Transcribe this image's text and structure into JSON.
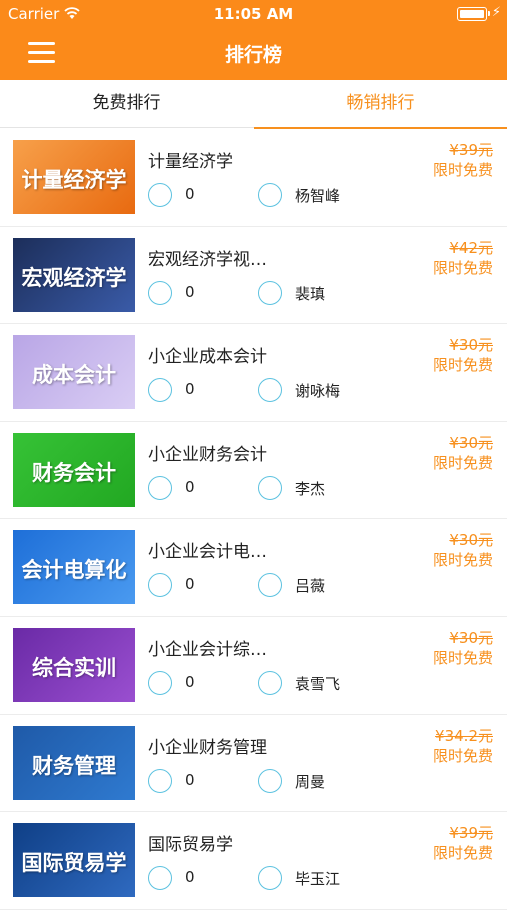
{
  "status_bar": {
    "carrier": "Carrier",
    "time": "11:05 AM"
  },
  "nav": {
    "title": "排行榜"
  },
  "tabs": [
    {
      "label": "免费排行",
      "active": false
    },
    {
      "label": "畅销排行",
      "active": true
    }
  ],
  "colors": {
    "brand": "#fb8a1a",
    "accent": "#f7901e",
    "icon": "#5cc2e0"
  },
  "courses": [
    {
      "thumb_text": "计量经济学",
      "title": "计量经济学",
      "views": "0",
      "teacher": "杨智峰",
      "price": "¥39元",
      "promo": "限时免费"
    },
    {
      "thumb_text": "宏观经济学",
      "title": "宏观经济学视…",
      "views": "0",
      "teacher": "裴瑱",
      "price": "¥42元",
      "promo": "限时免费"
    },
    {
      "thumb_text": "成本会计",
      "title": "小企业成本会计",
      "views": "0",
      "teacher": "谢咏梅",
      "price": "¥30元",
      "promo": "限时免费"
    },
    {
      "thumb_text": "财务会计",
      "title": "小企业财务会计",
      "views": "0",
      "teacher": "李杰",
      "price": "¥30元",
      "promo": "限时免费"
    },
    {
      "thumb_text": "会计电算化",
      "title": "小企业会计电…",
      "views": "0",
      "teacher": "吕薇",
      "price": "¥30元",
      "promo": "限时免费"
    },
    {
      "thumb_text": "综合实训",
      "title": "小企业会计综…",
      "views": "0",
      "teacher": "袁雪飞",
      "price": "¥30元",
      "promo": "限时免费"
    },
    {
      "thumb_text": "财务管理",
      "title": "小企业财务管理",
      "views": "0",
      "teacher": "周曼",
      "price": "¥34.2元",
      "promo": "限时免费"
    },
    {
      "thumb_text": "国际贸易学",
      "title": "国际贸易学",
      "views": "0",
      "teacher": "毕玉江",
      "price": "¥39元",
      "promo": "限时免费"
    }
  ]
}
